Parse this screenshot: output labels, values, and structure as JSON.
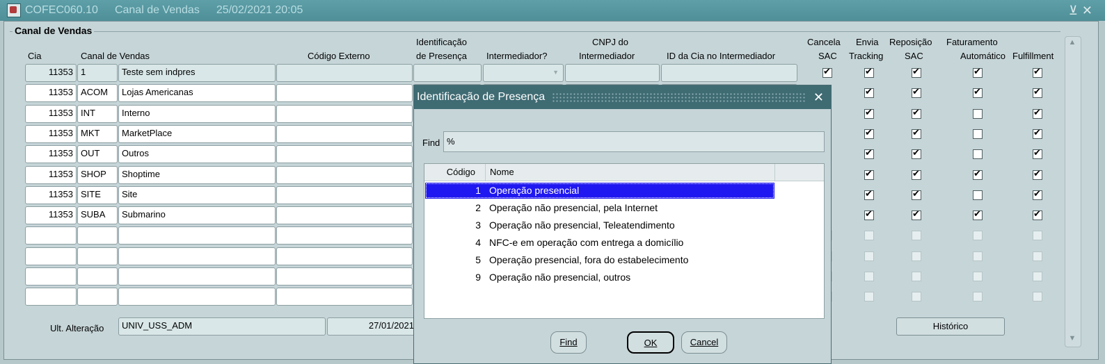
{
  "window": {
    "title_code": "COFEC060.10",
    "title_name": "Canal de Vendas",
    "title_datetime": "25/02/2021 20:05",
    "min_glyph": "⊻",
    "close_glyph": "✕"
  },
  "form": {
    "group_label": "Canal de Vendas",
    "headers": {
      "cia": "Cia",
      "canal": "Canal de Vendas",
      "codigo_externo": "Código Externo",
      "ident_presenca_1": "Identificação",
      "ident_presenca_2": "de Presença",
      "intermediador": "Intermediador?",
      "cnpj_1": "CNPJ do",
      "cnpj_2": "Intermediador",
      "id_cia": "ID da Cia no Intermediador",
      "cancela_1": "Cancela",
      "cancela_2": "SAC",
      "envia_1": "Envia",
      "envia_2": "Tracking",
      "reposicao_1": "Reposição",
      "reposicao_2": "SAC",
      "faturamento_1": "Faturamento",
      "faturamento_2": "Automático",
      "fulfillment": "Fulfillment"
    },
    "rows": [
      {
        "cia": "11353",
        "code": "1",
        "name": "Teste sem indpres",
        "cancela": true,
        "envia": true,
        "reposicao": true,
        "faturamento": true,
        "fulfillment": true
      },
      {
        "cia": "11353",
        "code": "ACOM",
        "name": "Lojas Americanas",
        "cancela": null,
        "envia": true,
        "reposicao": true,
        "faturamento": true,
        "fulfillment": true
      },
      {
        "cia": "11353",
        "code": "INT",
        "name": "Interno",
        "cancela": null,
        "envia": true,
        "reposicao": true,
        "faturamento": false,
        "fulfillment": true
      },
      {
        "cia": "11353",
        "code": "MKT",
        "name": "MarketPlace",
        "cancela": null,
        "envia": true,
        "reposicao": true,
        "faturamento": false,
        "fulfillment": true
      },
      {
        "cia": "11353",
        "code": "OUT",
        "name": "Outros",
        "cancela": null,
        "envia": true,
        "reposicao": true,
        "faturamento": false,
        "fulfillment": true
      },
      {
        "cia": "11353",
        "code": "SHOP",
        "name": "Shoptime",
        "cancela": null,
        "envia": true,
        "reposicao": true,
        "faturamento": true,
        "fulfillment": true
      },
      {
        "cia": "11353",
        "code": "SITE",
        "name": "Site",
        "cancela": null,
        "envia": true,
        "reposicao": true,
        "faturamento": false,
        "fulfillment": true
      },
      {
        "cia": "11353",
        "code": "SUBA",
        "name": "Submarino",
        "cancela": null,
        "envia": true,
        "reposicao": true,
        "faturamento": true,
        "fulfillment": true
      }
    ],
    "footer": {
      "label": "Ult. Alteração",
      "user": "UNIV_USS_ADM",
      "date": "27/01/2021",
      "historico_button": "Histórico"
    }
  },
  "dialog": {
    "title": "Identificação de Presença",
    "close_glyph": "✕",
    "find_label": "Find",
    "find_value": "%",
    "columns": {
      "codigo": "Código",
      "nome": "Nome"
    },
    "items": [
      {
        "codigo": "1",
        "nome": "Operação presencial"
      },
      {
        "codigo": "2",
        "nome": "Operação não presencial, pela Internet"
      },
      {
        "codigo": "3",
        "nome": "Operação não presencial, Teleatendimento"
      },
      {
        "codigo": "4",
        "nome": "NFC-e em operação com entrega a domicílio"
      },
      {
        "codigo": "5",
        "nome": "Operação presencial, fora do estabelecimento"
      },
      {
        "codigo": "9",
        "nome": "Operação não presencial, outros"
      }
    ],
    "selected_index": 0,
    "buttons": {
      "find": "Find",
      "ok": "OK",
      "cancel": "Cancel"
    }
  }
}
